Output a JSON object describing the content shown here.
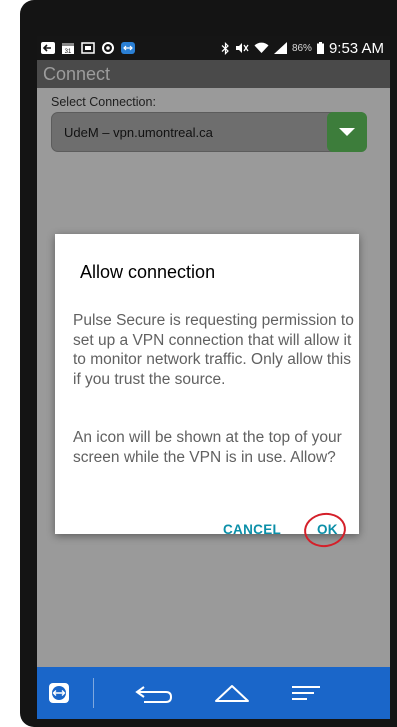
{
  "status_bar": {
    "battery_percent": "86%",
    "time": "9:53 AM"
  },
  "app_bar": {
    "title": "Connect"
  },
  "connection": {
    "label": "Select Connection:",
    "selected_value": "UdeM – vpn.umontreal.ca"
  },
  "dialog": {
    "title": "Allow connection",
    "message_1": "Pulse Secure is requesting permission to set up a VPN connection that will allow it to monitor network traffic. Only allow this if you trust the source.",
    "message_2": "An icon will be shown at the top of your screen while the VPN is in use. Allow?",
    "cancel_label": "CANCEL",
    "ok_label": "OK"
  },
  "colors": {
    "dialog_button": "#0b8fa8",
    "nav_bar": "#1a66c9",
    "select_button": "#3d7d3b",
    "annotation_circle": "#d4202a"
  }
}
